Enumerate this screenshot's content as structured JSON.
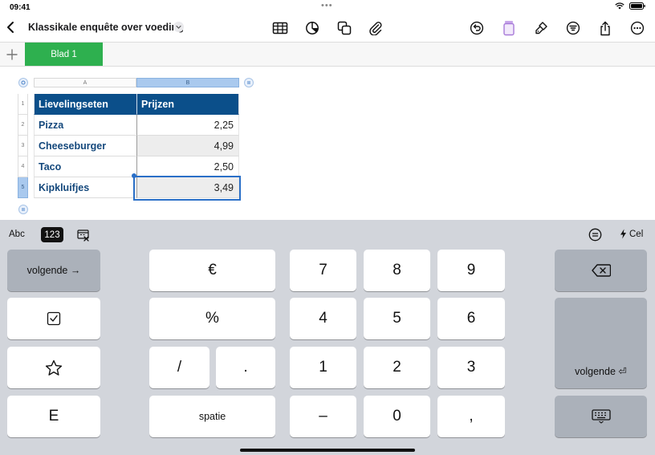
{
  "status": {
    "time": "09:41"
  },
  "toolbar": {
    "doc_title": "Klassikale enquête over voeding",
    "icons": [
      "back-icon",
      "table-icon",
      "chart-icon",
      "shapes-icon",
      "paperclip-icon",
      "undo-icon",
      "collaborate-icon",
      "format-brush-icon",
      "organize-icon",
      "share-icon",
      "more-icon"
    ]
  },
  "tabs": {
    "sheet_name": "Blad 1"
  },
  "sheet": {
    "columns": [
      "A",
      "B"
    ],
    "rows": [
      {
        "num": "1",
        "a": "Lievelingseten",
        "b": "Prijzen"
      },
      {
        "num": "2",
        "a": "Pizza",
        "b": "2,25"
      },
      {
        "num": "3",
        "a": "Cheeseburger",
        "b": "4,99"
      },
      {
        "num": "4",
        "a": "Taco",
        "b": "2,50"
      },
      {
        "num": "5",
        "a": "Kipkluifjes",
        "b": "3,49"
      }
    ],
    "colors": {
      "header_bg": "#0b4f8a",
      "selection": "#2a6fc7",
      "label_text": "#14487c"
    }
  },
  "keyboard": {
    "mode_text": "Abc",
    "mode_number": "123",
    "cell_label": "Cel",
    "keys": {
      "next": "volgende →",
      "euro": "€",
      "percent": "%",
      "slash": "/",
      "dot": ".",
      "space": "spatie",
      "n7": "7",
      "n8": "8",
      "n9": "9",
      "n4": "4",
      "n5": "5",
      "n6": "6",
      "n1": "1",
      "n2": "2",
      "n3": "3",
      "minus": "–",
      "n0": "0",
      "comma": ",",
      "e": "E",
      "return": "volgende ⏎"
    }
  }
}
